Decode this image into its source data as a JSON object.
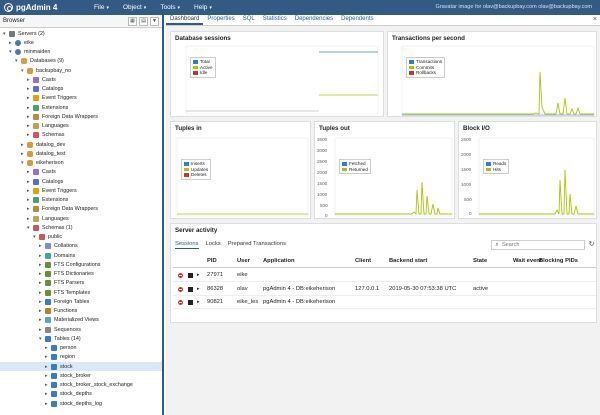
{
  "app": {
    "title": "pgAdmin 4",
    "menu": [
      "File",
      "Object",
      "Tools",
      "Help"
    ],
    "user": "Gravatar image for olav@backupbay.com olav@backupbay.com",
    "brand_color": "#325a83"
  },
  "browser": {
    "title": "Browser",
    "tree": [
      {
        "label": "Servers (2)",
        "depth": 0,
        "toggle": "▾",
        "icon": "server"
      },
      {
        "label": "eike",
        "depth": 1,
        "toggle": "▸",
        "icon": "elephant"
      },
      {
        "label": "minmaiden",
        "depth": 1,
        "toggle": "▾",
        "icon": "elephant"
      },
      {
        "label": "Databases (9)",
        "depth": 2,
        "toggle": "▾",
        "icon": "db"
      },
      {
        "label": "backupbay_no",
        "depth": 3,
        "toggle": "▾",
        "icon": "db"
      },
      {
        "label": "Casts",
        "depth": 4,
        "toggle": "▸",
        "icon": "cast"
      },
      {
        "label": "Catalogs",
        "depth": 4,
        "toggle": "▸",
        "icon": "catalog"
      },
      {
        "label": "Event Triggers",
        "depth": 4,
        "toggle": "▸",
        "icon": "trigger"
      },
      {
        "label": "Extensions",
        "depth": 4,
        "toggle": "▸",
        "icon": "ext"
      },
      {
        "label": "Foreign Data Wrappers",
        "depth": 4,
        "toggle": "▸",
        "icon": "fdw"
      },
      {
        "label": "Languages",
        "depth": 4,
        "toggle": "▸",
        "icon": "lang"
      },
      {
        "label": "Schemas",
        "depth": 4,
        "toggle": "▸",
        "icon": "schema"
      },
      {
        "label": "datalog_dev",
        "depth": 3,
        "toggle": "▸",
        "icon": "db"
      },
      {
        "label": "datalog_test",
        "depth": 3,
        "toggle": "▸",
        "icon": "db"
      },
      {
        "label": "eikeherison",
        "depth": 3,
        "toggle": "▾",
        "icon": "db"
      },
      {
        "label": "Casts",
        "depth": 4,
        "toggle": "▸",
        "icon": "cast"
      },
      {
        "label": "Catalogs",
        "depth": 4,
        "toggle": "▸",
        "icon": "catalog"
      },
      {
        "label": "Event Triggers",
        "depth": 4,
        "toggle": "▸",
        "icon": "trigger"
      },
      {
        "label": "Extensions",
        "depth": 4,
        "toggle": "▸",
        "icon": "ext"
      },
      {
        "label": "Foreign Data Wrappers",
        "depth": 4,
        "toggle": "▸",
        "icon": "fdw"
      },
      {
        "label": "Languages",
        "depth": 4,
        "toggle": "▸",
        "icon": "lang"
      },
      {
        "label": "Schemas (1)",
        "depth": 4,
        "toggle": "▾",
        "icon": "schema"
      },
      {
        "label": "public",
        "depth": 5,
        "toggle": "▾",
        "icon": "schema"
      },
      {
        "label": "Collations",
        "depth": 6,
        "toggle": "▸",
        "icon": "coll"
      },
      {
        "label": "Domains",
        "depth": 6,
        "toggle": "▸",
        "icon": "domain"
      },
      {
        "label": "FTS Configurations",
        "depth": 6,
        "toggle": "▸",
        "icon": "fts"
      },
      {
        "label": "FTS Dictionaries",
        "depth": 6,
        "toggle": "▸",
        "icon": "fts"
      },
      {
        "label": "FTS Parsers",
        "depth": 6,
        "toggle": "▸",
        "icon": "fts"
      },
      {
        "label": "FTS Templates",
        "depth": 6,
        "toggle": "▸",
        "icon": "fts"
      },
      {
        "label": "Foreign Tables",
        "depth": 6,
        "toggle": "▸",
        "icon": "table"
      },
      {
        "label": "Functions",
        "depth": 6,
        "toggle": "▸",
        "icon": "func"
      },
      {
        "label": "Materialized Views",
        "depth": 6,
        "toggle": "▸",
        "icon": "view"
      },
      {
        "label": "Sequences",
        "depth": 6,
        "toggle": "▸",
        "icon": "seq"
      },
      {
        "label": "Tables (14)",
        "depth": 6,
        "toggle": "▾",
        "icon": "table"
      },
      {
        "label": "person",
        "depth": 7,
        "toggle": "▸",
        "icon": "table"
      },
      {
        "label": "region",
        "depth": 7,
        "toggle": "▸",
        "icon": "table"
      },
      {
        "label": "stock",
        "depth": 7,
        "toggle": "▸",
        "icon": "table",
        "selected": true
      },
      {
        "label": "stock_broker",
        "depth": 7,
        "toggle": "▸",
        "icon": "table"
      },
      {
        "label": "stock_broker_stock_exchange",
        "depth": 7,
        "toggle": "▸",
        "icon": "table"
      },
      {
        "label": "stock_depths",
        "depth": 7,
        "toggle": "▸",
        "icon": "table"
      },
      {
        "label": "stock_depths_log",
        "depth": 7,
        "toggle": "▸",
        "icon": "table"
      }
    ]
  },
  "tabs": [
    "Dashboard",
    "Properties",
    "SQL",
    "Statistics",
    "Dependencies",
    "Dependents"
  ],
  "active_tab": "Dashboard",
  "dashboard": {
    "sessions": {
      "title": "Database sessions",
      "legend": [
        {
          "label": "Total",
          "color": "#2f80c8"
        },
        {
          "label": "Active",
          "color": "#a6c60a"
        },
        {
          "label": "Idle",
          "color": "#c0392b"
        }
      ]
    },
    "tps": {
      "title": "Transactions per second",
      "legend": [
        {
          "label": "Transactions",
          "color": "#2f80c8"
        },
        {
          "label": "Commits",
          "color": "#a6c60a"
        },
        {
          "label": "Rollbacks",
          "color": "#c0392b"
        }
      ]
    },
    "tuples_in": {
      "title": "Tuples in",
      "legend": [
        {
          "label": "Inserts",
          "color": "#2f80c8"
        },
        {
          "label": "Updates",
          "color": "#a6c60a"
        },
        {
          "label": "Deletes",
          "color": "#c0392b"
        }
      ]
    },
    "tuples_out": {
      "title": "Tuples out",
      "legend": [
        {
          "label": "Fetched",
          "color": "#2f80c8"
        },
        {
          "label": "Returned",
          "color": "#a6c60a"
        }
      ],
      "y_ticks": [
        "3500",
        "3000",
        "2500",
        "2000",
        "1500",
        "1000",
        "500",
        "0"
      ]
    },
    "block_io": {
      "title": "Block I/O",
      "legend": [
        {
          "label": "Reads",
          "color": "#2f80c8"
        },
        {
          "label": "Hits",
          "color": "#a6c60a"
        }
      ],
      "y_ticks": [
        "2500",
        "2000",
        "1500",
        "1000",
        "500",
        "0"
      ]
    }
  },
  "activity": {
    "title": "Server activity",
    "subtabs": [
      "Sessions",
      "Locks",
      "Prepared Transactions"
    ],
    "active_subtab": "Sessions",
    "search_placeholder": "Search",
    "columns": [
      "PID",
      "User",
      "Application",
      "Client",
      "Backend start",
      "State",
      "Wait event",
      "Blocking PIDs"
    ],
    "rows": [
      [
        "27971",
        "eike",
        "",
        "",
        "",
        "",
        "",
        ""
      ],
      [
        "86328",
        "olav",
        "pgAdmin 4 - DB:eikeherison",
        "127.0.0.1",
        "2019-05-30 07:53:38 UTC",
        "active",
        "",
        ""
      ],
      [
        "90821",
        "eike_les",
        "pgAdmin 4 - DB:eikeherison",
        "",
        "",
        "",
        "",
        ""
      ]
    ]
  }
}
